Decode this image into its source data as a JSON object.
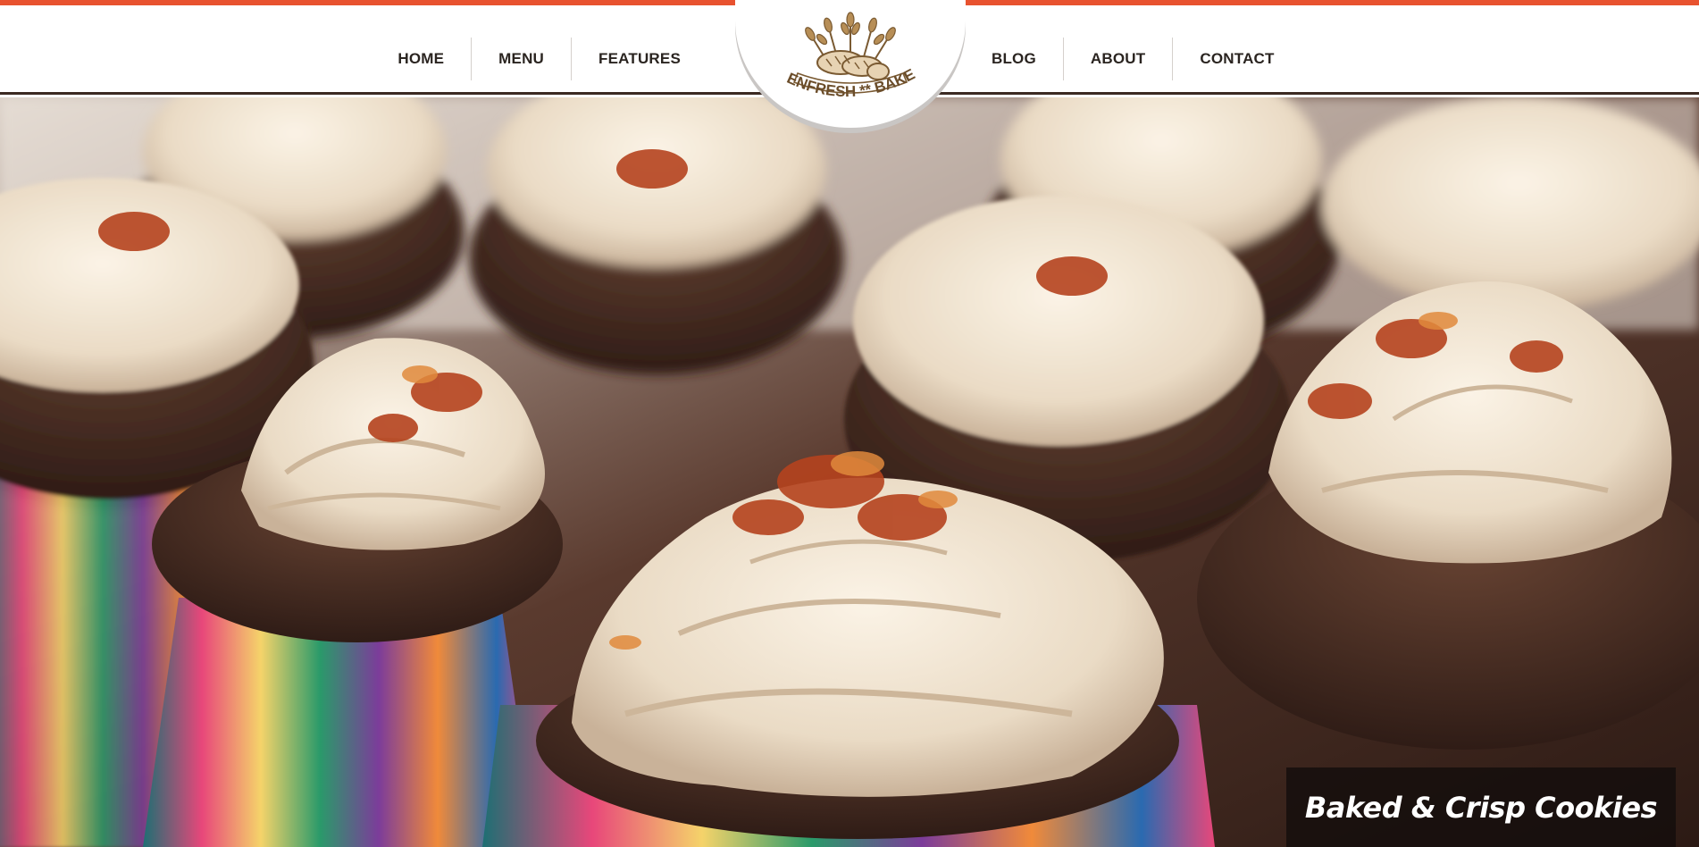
{
  "nav": {
    "left": [
      "HOME",
      "MENU",
      "FEATURES"
    ],
    "right": [
      "BLOG",
      "ABOUT",
      "CONTACT"
    ]
  },
  "logo": {
    "text": "OVENFRESH ** BAKERY",
    "icon": "wheat-bread-icon"
  },
  "hero": {
    "image": "frosted-cupcakes-photo",
    "caption": "Baked & Crisp Cookies"
  },
  "colors": {
    "accent": "#e8522f",
    "header_border": "#3b2a22",
    "logo_brown": "#7a5a32",
    "caption_bg": "#140e0c"
  }
}
